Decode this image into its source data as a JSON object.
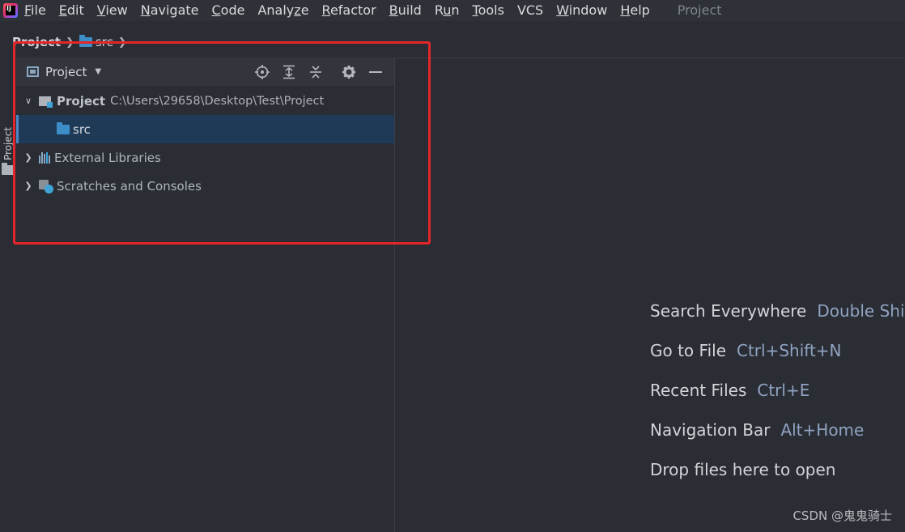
{
  "menubar": {
    "items": [
      {
        "pre": "",
        "mn": "F",
        "post": "ile"
      },
      {
        "pre": "",
        "mn": "E",
        "post": "dit"
      },
      {
        "pre": "",
        "mn": "V",
        "post": "iew"
      },
      {
        "pre": "",
        "mn": "N",
        "post": "avigate"
      },
      {
        "pre": "",
        "mn": "C",
        "post": "ode"
      },
      {
        "pre": "Analy",
        "mn": "z",
        "post": "e"
      },
      {
        "pre": "",
        "mn": "R",
        "post": "efactor"
      },
      {
        "pre": "",
        "mn": "B",
        "post": "uild"
      },
      {
        "pre": "R",
        "mn": "u",
        "post": "n"
      },
      {
        "pre": "",
        "mn": "T",
        "post": "ools"
      },
      {
        "pre": "VCS",
        "mn": "",
        "post": ""
      },
      {
        "pre": "",
        "mn": "W",
        "post": "indow"
      },
      {
        "pre": "",
        "mn": "H",
        "post": "elp"
      }
    ],
    "window_title": "Project"
  },
  "breadcrumb": {
    "root": "Project",
    "child": "src"
  },
  "tool_stripe": {
    "label": "Project"
  },
  "panel": {
    "title": "Project",
    "tree": {
      "project_name": "Project",
      "project_path": "C:\\Users\\29658\\Desktop\\Test\\Project",
      "src": "src",
      "external_libraries": "External Libraries",
      "scratches": "Scratches and Consoles"
    }
  },
  "editor": {
    "hints": [
      {
        "label": "Search Everywhere",
        "key": "Double Shift"
      },
      {
        "label": "Go to File",
        "key": "Ctrl+Shift+N"
      },
      {
        "label": "Recent Files",
        "key": "Ctrl+E"
      },
      {
        "label": "Navigation Bar",
        "key": "Alt+Home"
      },
      {
        "label": "Drop files here to open",
        "key": ""
      }
    ]
  },
  "watermark": "CSDN @鬼鬼骑士",
  "colors": {
    "background": "#2b2d35",
    "selection": "#1e3a56",
    "highlight_box": "#e3262a",
    "folder": "#3c8dc8"
  }
}
